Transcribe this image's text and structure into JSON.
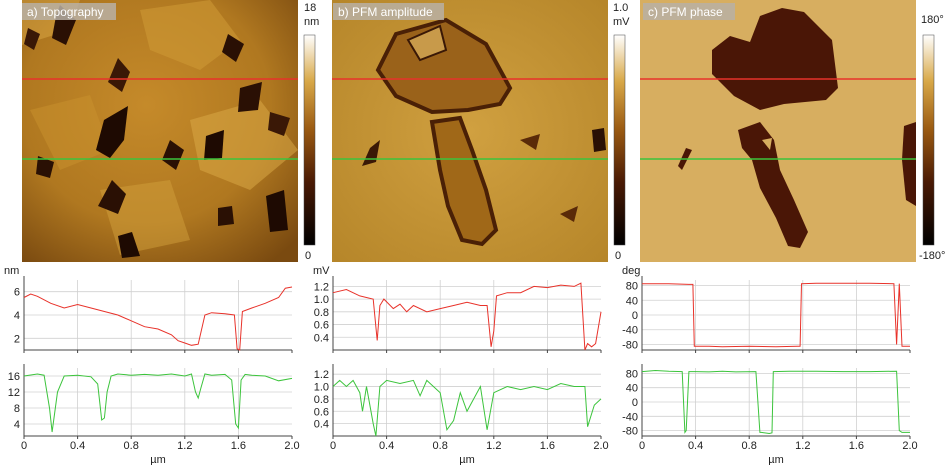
{
  "chart_data": [
    {
      "type": "heatmap",
      "title": "a) Topography",
      "colorbar": {
        "max": "18",
        "unit": "nm",
        "min": "0"
      },
      "colormap": "copper",
      "line_profiles": [
        {
          "color": "#e8322a",
          "y_fraction_of_scan": 0.27
        },
        {
          "color": "#3cc43c",
          "y_fraction_of_scan": 0.53
        }
      ]
    },
    {
      "type": "heatmap",
      "title": "b) PFM amplitude",
      "colorbar": {
        "max": "1.0",
        "unit": "mV",
        "min": "0"
      },
      "colormap": "copper",
      "line_profiles": [
        {
          "color": "#e8322a",
          "y_fraction_of_scan": 0.27
        },
        {
          "color": "#3cc43c",
          "y_fraction_of_scan": 0.53
        }
      ]
    },
    {
      "type": "heatmap",
      "title": "c) PFM phase",
      "colorbar": {
        "max": "180°",
        "unit": "",
        "min": "-180°"
      },
      "colormap": "copper",
      "line_profiles": [
        {
          "color": "#e8322a",
          "y_fraction_of_scan": 0.27
        },
        {
          "color": "#3cc43c",
          "y_fraction_of_scan": 0.53
        }
      ]
    },
    {
      "type": "line",
      "ylabel": "nm",
      "ylim": [
        1,
        7
      ],
      "yticks": [
        "2",
        "4",
        "6"
      ],
      "series": [
        {
          "color": "#e8322a",
          "x": [
            0,
            0.05,
            0.1,
            0.2,
            0.3,
            0.4,
            0.5,
            0.6,
            0.7,
            0.8,
            0.9,
            1.0,
            1.1,
            1.15,
            1.2,
            1.25,
            1.3,
            1.35,
            1.4,
            1.5,
            1.57,
            1.59,
            1.61,
            1.63,
            1.7,
            1.8,
            1.9,
            1.95,
            2.0
          ],
          "y": [
            5.5,
            5.8,
            5.6,
            5.0,
            4.6,
            4.9,
            4.6,
            4.3,
            4.0,
            3.5,
            3.0,
            2.8,
            2.3,
            1.8,
            1.6,
            1.4,
            1.5,
            4.0,
            4.2,
            4.1,
            4.0,
            1.1,
            1.0,
            4.3,
            4.6,
            5.0,
            5.5,
            6.3,
            6.4
          ]
        }
      ]
    },
    {
      "type": "line",
      "ylim": [
        1,
        18
      ],
      "yticks": [
        "4",
        "8",
        "12",
        "16"
      ],
      "xticks": [
        "0",
        "0.4",
        "0.8",
        "1.2",
        "1.6",
        "2.0"
      ],
      "xlabel": "µm",
      "xlim": [
        0,
        2.0
      ],
      "series": [
        {
          "color": "#3cc43c",
          "x": [
            0,
            0.1,
            0.15,
            0.19,
            0.21,
            0.25,
            0.3,
            0.4,
            0.5,
            0.55,
            0.58,
            0.6,
            0.62,
            0.65,
            0.7,
            0.8,
            0.9,
            1.0,
            1.1,
            1.2,
            1.25,
            1.28,
            1.3,
            1.32,
            1.35,
            1.4,
            1.5,
            1.55,
            1.58,
            1.6,
            1.62,
            1.65,
            1.7,
            1.8,
            1.9,
            2.0
          ],
          "y": [
            16,
            16.5,
            16.2,
            8,
            2,
            12,
            16,
            16.2,
            15.8,
            14,
            5,
            5.5,
            12,
            16,
            16.5,
            16.2,
            16.4,
            16.2,
            16.5,
            16.0,
            16.5,
            12,
            10.5,
            13,
            16.5,
            16.2,
            16.4,
            15,
            4,
            3,
            15,
            16.4,
            16.2,
            16.0,
            14.8,
            15.4
          ]
        }
      ]
    },
    {
      "type": "line",
      "ylabel": "mV",
      "ylim": [
        0.2,
        1.3
      ],
      "yticks": [
        "0.4",
        "0.6",
        "0.8",
        "1.0",
        "1.2"
      ],
      "series": [
        {
          "color": "#e8322a",
          "x": [
            0,
            0.1,
            0.2,
            0.3,
            0.33,
            0.35,
            0.38,
            0.45,
            0.5,
            0.55,
            0.6,
            0.7,
            0.8,
            0.9,
            1.0,
            1.1,
            1.15,
            1.18,
            1.2,
            1.22,
            1.3,
            1.4,
            1.5,
            1.6,
            1.7,
            1.8,
            1.85,
            1.88,
            1.9,
            1.93,
            1.96,
            2.0
          ],
          "y": [
            1.1,
            1.15,
            1.05,
            1.0,
            0.35,
            0.9,
            1.0,
            0.85,
            0.92,
            0.8,
            0.9,
            0.8,
            0.85,
            0.9,
            0.95,
            0.9,
            0.9,
            0.25,
            0.5,
            1.05,
            1.1,
            1.1,
            1.2,
            1.18,
            1.22,
            1.2,
            1.25,
            0.2,
            0.3,
            0.25,
            0.3,
            0.8
          ]
        }
      ]
    },
    {
      "type": "line",
      "ylim": [
        0.2,
        1.3
      ],
      "yticks": [
        "0.4",
        "0.6",
        "0.8",
        "1.0",
        "1.2"
      ],
      "xticks": [
        "0",
        "0.4",
        "0.8",
        "1.2",
        "1.6",
        "2.0"
      ],
      "xlabel": "µm",
      "xlim": [
        0,
        2.0
      ],
      "series": [
        {
          "color": "#3cc43c",
          "x": [
            0,
            0.05,
            0.1,
            0.15,
            0.2,
            0.22,
            0.25,
            0.3,
            0.32,
            0.35,
            0.4,
            0.5,
            0.6,
            0.65,
            0.7,
            0.8,
            0.85,
            0.9,
            0.95,
            1.0,
            1.05,
            1.1,
            1.15,
            1.2,
            1.3,
            1.4,
            1.5,
            1.6,
            1.7,
            1.8,
            1.88,
            1.9,
            1.95,
            2.0
          ],
          "y": [
            1.0,
            1.1,
            1.0,
            1.1,
            0.9,
            0.6,
            1.0,
            0.4,
            0.2,
            1.0,
            1.1,
            1.05,
            1.1,
            0.85,
            1.1,
            0.9,
            0.3,
            0.45,
            0.9,
            0.6,
            0.8,
            1.0,
            0.3,
            0.9,
            1.0,
            0.95,
            1.0,
            0.95,
            1.05,
            1.0,
            1.0,
            0.35,
            0.7,
            0.8
          ]
        }
      ]
    },
    {
      "type": "line",
      "ylabel": "deg",
      "ylim": [
        -95,
        95
      ],
      "yticks": [
        "80",
        "40",
        "0",
        "-40",
        "-80"
      ],
      "series": [
        {
          "color": "#e8322a",
          "x": [
            0,
            0.2,
            0.35,
            0.38,
            0.39,
            0.5,
            0.6,
            0.8,
            1.0,
            1.16,
            1.18,
            1.19,
            1.3,
            1.5,
            1.7,
            1.88,
            1.9,
            1.92,
            1.94,
            1.96,
            2.0
          ],
          "y": [
            85,
            85,
            83,
            83,
            -85,
            -85,
            -86,
            -85,
            -86,
            -85,
            -85,
            85,
            86,
            86,
            86,
            85,
            -80,
            85,
            -85,
            -85,
            -85
          ]
        }
      ]
    },
    {
      "type": "line",
      "ylim": [
        -95,
        95
      ],
      "yticks": [
        "80",
        "40",
        "0",
        "-40",
        "-80"
      ],
      "xticks": [
        "0",
        "0.4",
        "0.8",
        "1.2",
        "1.6",
        "2.0"
      ],
      "xlabel": "µm",
      "xlim": [
        0,
        2.0
      ],
      "series": [
        {
          "color": "#3cc43c",
          "x": [
            0,
            0.1,
            0.2,
            0.3,
            0.32,
            0.33,
            0.35,
            0.4,
            0.5,
            0.6,
            0.7,
            0.85,
            0.88,
            0.89,
            0.95,
            0.97,
            0.98,
            1.1,
            1.3,
            1.5,
            1.7,
            1.9,
            1.92,
            1.94,
            2.0
          ],
          "y": [
            85,
            88,
            86,
            85,
            -85,
            -80,
            85,
            85,
            84,
            86,
            84,
            85,
            -85,
            -85,
            -88,
            -86,
            85,
            86,
            86,
            85,
            85,
            86,
            -80,
            -85,
            -85
          ]
        }
      ]
    }
  ]
}
